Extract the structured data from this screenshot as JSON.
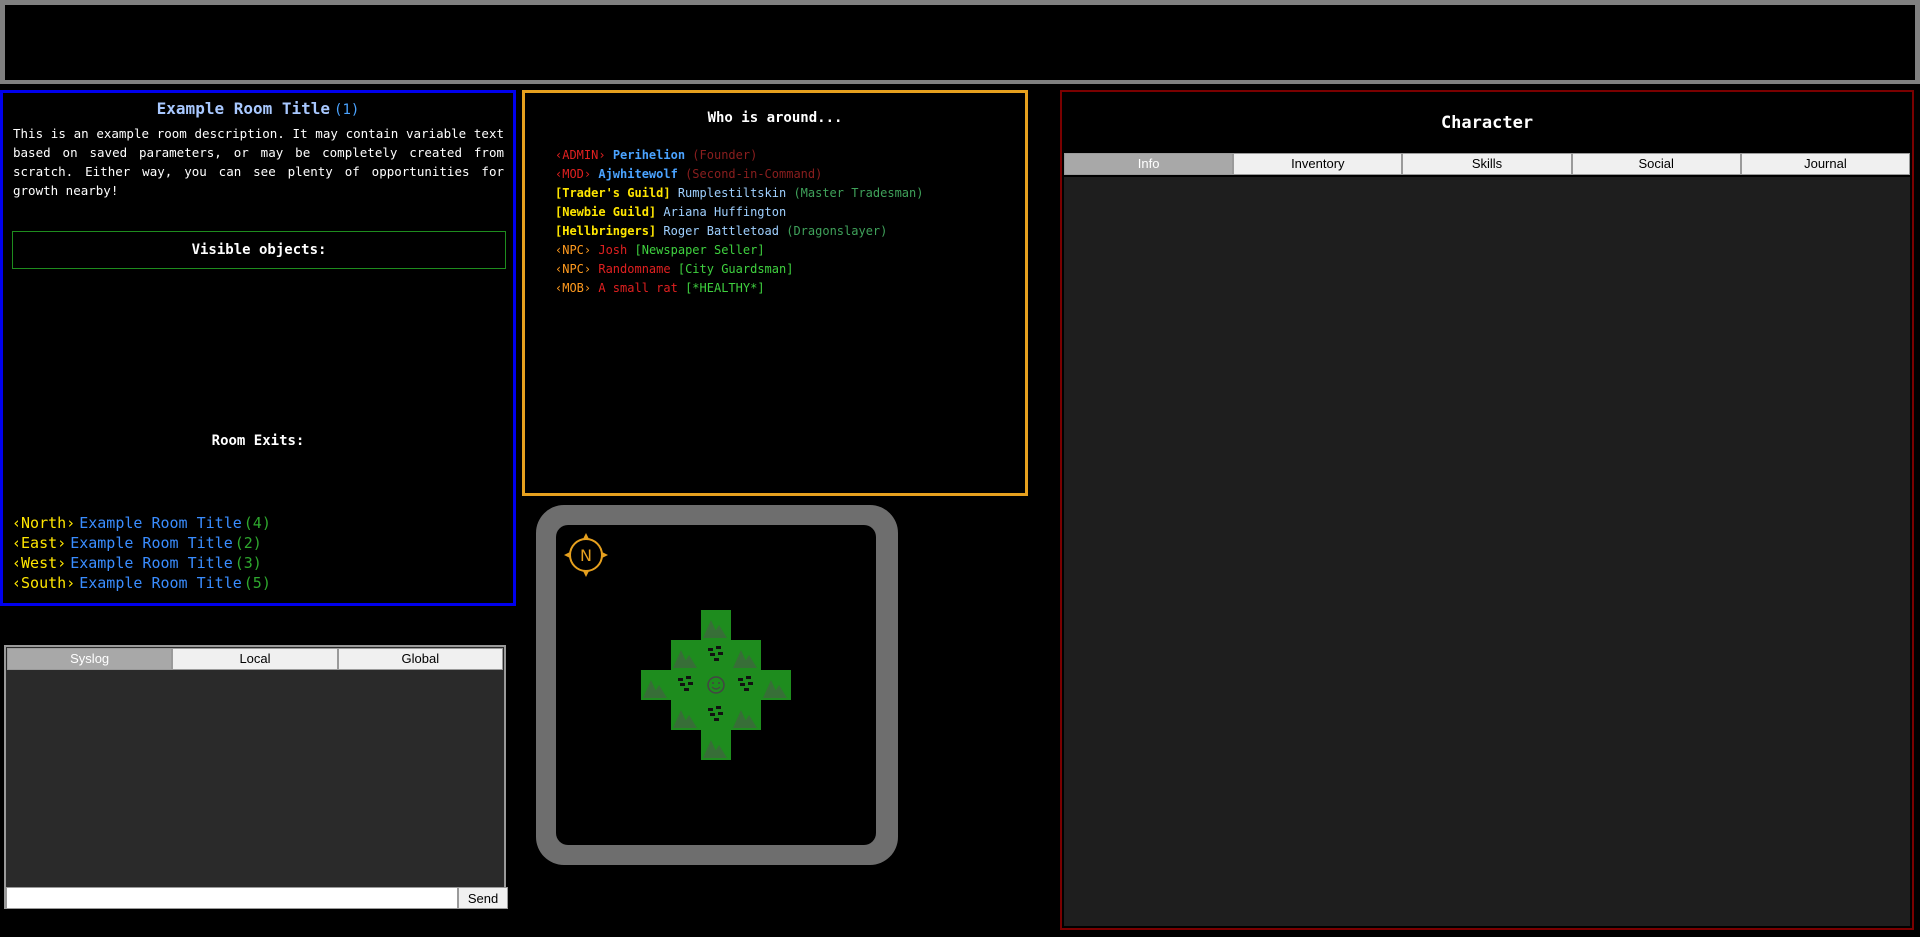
{
  "room": {
    "title": "Example Room Title",
    "number": "(1)",
    "description": "This is an example room description. It may contain variable text based on saved parameters, or may be completely created from scratch. Either way, you can see plenty of opportunities for growth nearby!",
    "visible_objects_label": "Visible objects:",
    "exits_label": "Room Exits:",
    "exits": [
      {
        "dir": "‹North›",
        "name": "Example Room Title",
        "num": "(4)"
      },
      {
        "dir": "‹East›",
        "name": "Example Room Title",
        "num": "(2)"
      },
      {
        "dir": "‹West›",
        "name": "Example Room Title",
        "num": "(3)"
      },
      {
        "dir": "‹South›",
        "name": "Example Room Title",
        "num": "(5)"
      }
    ]
  },
  "who": {
    "title": "Who is around...",
    "entries": [
      {
        "tag": "‹ADMIN›",
        "name": "Perihelion",
        "title": "(Founder)"
      },
      {
        "tag": "‹MOD›",
        "name": "Ajwhitewolf",
        "title": "(Second-in-Command)"
      },
      {
        "tag": "[Trader's Guild]",
        "name": "Rumplestiltskin",
        "title": "(Master Tradesman)"
      },
      {
        "tag": "[Newbie Guild]",
        "name": "Ariana Huffington",
        "title": ""
      },
      {
        "tag": "[Hellbringers]",
        "name": "Roger Battletoad",
        "title": "(Dragonslayer)"
      },
      {
        "tag": "‹NPC›",
        "name": "Josh",
        "title": "[Newspaper Seller]"
      },
      {
        "tag": "‹NPC›",
        "name": "Randomname",
        "title": "[City Guardsman]"
      },
      {
        "tag": "‹MOB›",
        "name": "A small rat",
        "title": "[*HEALTHY*]"
      }
    ]
  },
  "map": {
    "compass_letter": "N",
    "terrain_color": "#1e8c1e",
    "compass_color": "#e6a01e"
  },
  "character": {
    "title": "Character",
    "tabs": [
      "Info",
      "Inventory",
      "Skills",
      "Social",
      "Journal"
    ],
    "active_tab": "Info"
  },
  "chat": {
    "tabs": [
      "Syslog",
      "Local",
      "Global"
    ],
    "active_tab": "Syslog",
    "input_value": "",
    "send_label": "Send"
  },
  "colors": {
    "room_border": "#0000ee",
    "who_border": "#e6a01e",
    "character_border": "#7a0000"
  }
}
